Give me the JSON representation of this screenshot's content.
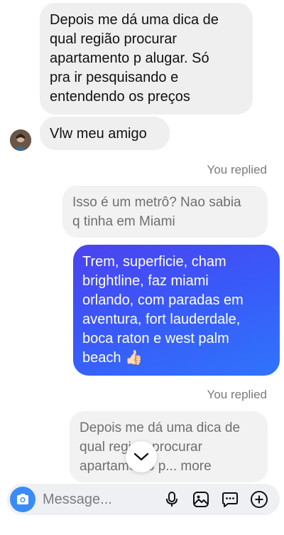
{
  "messages": {
    "incoming_1": "Depois me dá uma dica de\nqual região procurar\napartamento p alugar. Só\npra ir pesquisando e\nentendendo os preços",
    "incoming_2": "Vlw meu amigo",
    "replied_label_1": "You replied",
    "quote_1": "Isso é um metrô? Nao sabia\nq tinha em Miami",
    "outgoing_1": "Trem, superficie, cham\nbrightline, faz miami\norlando, com paradas em\naventura, fort lauderdale,\nboca raton e west palm\nbeach",
    "outgoing_emoji": "👍🏻",
    "replied_label_2": "You replied",
    "quote_2_line1": "Depois me dá uma dica de",
    "quote_2_line2a": "qual regi",
    "quote_2_line2b": " procurar",
    "quote_2_line3a": "apartamen",
    "quote_2_line3b": "o p... more"
  },
  "composer": {
    "placeholder": "Message..."
  },
  "icons": {
    "camera": "camera-icon",
    "mic": "microphone-icon",
    "gallery": "image-icon",
    "sticker": "sticker-icon",
    "add": "plus-icon",
    "scroll": "chevron-down-icon"
  },
  "colors": {
    "outgoing_start": "#4d42ee",
    "outgoing_end": "#2f74fb",
    "camera_button": "#3b8bf5",
    "incoming_bubble": "#efefef"
  }
}
